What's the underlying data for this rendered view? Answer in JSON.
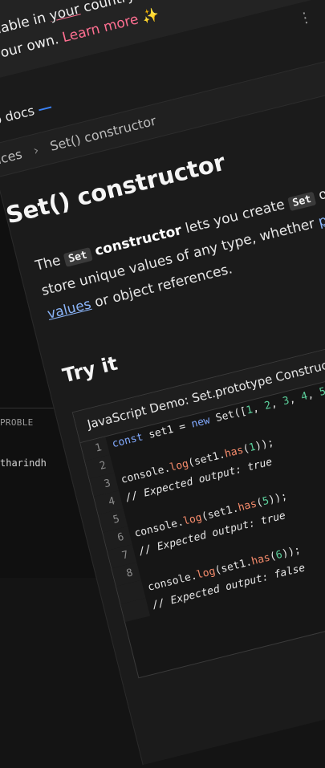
{
  "editor": {
    "line_numbers": [
      "1",
      "2",
      "3"
    ],
    "problems_tab": "PROBLE",
    "terminal_text": "tharindh"
  },
  "banner": {
    "text_part1": "w available in ",
    "text_underlined": "your",
    "text_part2": " country! Su",
    "text_line2": "ke it your own. ",
    "learn_more": "Learn more",
    "sparkle": "✨"
  },
  "nav": {
    "brand": "web docs",
    "menu_icon": "hamburger-icon",
    "more_icon": "kebab-icon"
  },
  "breadcrumb": {
    "items": [
      "rences",
      "Set() constructor"
    ],
    "separator": "›"
  },
  "article": {
    "title": "Set() constructor",
    "desc_1": "The ",
    "desc_code_1": "Set",
    "desc_bold": " constructor",
    "desc_2": " lets you create ",
    "desc_code_2": "Set",
    "desc_3": " objects that store unique values of any type, whether ",
    "desc_link": "primitive values",
    "desc_4": " or object references.",
    "try_it": "Try it"
  },
  "demo": {
    "title": "JavaScript Demo: Set.prototype Constructor",
    "lines": [
      {
        "num": "1"
      },
      {
        "num": "2"
      },
      {
        "num": "3"
      },
      {
        "num": "4"
      },
      {
        "num": "5"
      },
      {
        "num": "6"
      },
      {
        "num": "7"
      },
      {
        "num": "8"
      }
    ]
  },
  "colors": {
    "accent_link": "#8ab4f8",
    "learn_more": "#ff6f91",
    "number": "#5dd39e",
    "keyword": "#82aaff",
    "method": "#f78c6c"
  }
}
